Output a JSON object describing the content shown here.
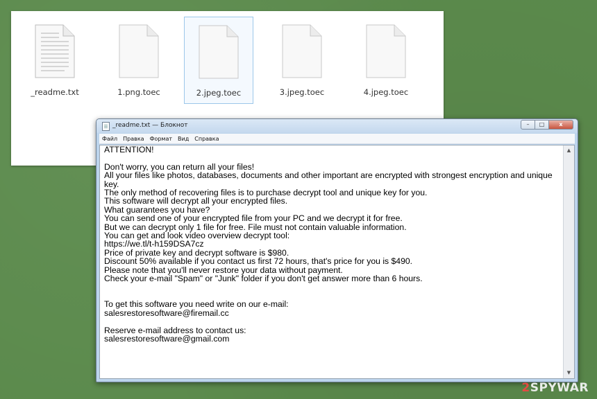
{
  "files": [
    {
      "name": "_readme.txt",
      "selected": false
    },
    {
      "name": "1.png.toec",
      "selected": false
    },
    {
      "name": "2.jpeg.toec",
      "selected": true
    },
    {
      "name": "3.jpeg.toec",
      "selected": false
    },
    {
      "name": "4.jpeg.toec",
      "selected": false
    }
  ],
  "notepad": {
    "title": "_readme.txt — Блокнот",
    "menu": [
      "Файл",
      "Правка",
      "Формат",
      "Вид",
      "Справка"
    ],
    "buttons": {
      "minimize": "–",
      "maximize": "□",
      "close": "x"
    },
    "scroll_up": "▲",
    "scroll_down": "▼",
    "content": "ATTENTION!\n\nDon't worry, you can return all your files!\nAll your files like photos, databases, documents and other important are encrypted with strongest encryption and unique key.\nThe only method of recovering files is to purchase decrypt tool and unique key for you.\nThis software will decrypt all your encrypted files.\nWhat guarantees you have?\nYou can send one of your encrypted file from your PC and we decrypt it for free.\nBut we can decrypt only 1 file for free. File must not contain valuable information.\nYou can get and look video overview decrypt tool:\nhttps://we.tl/t-h159DSA7cz\nPrice of private key and decrypt software is $980.\nDiscount 50% available if you contact us first 72 hours, that's price for you is $490.\nPlease note that you'll never restore your data without payment.\nCheck your e-mail \"Spam\" or \"Junk\" folder if you don't get answer more than 6 hours.\n\n\nTo get this software you need write on our e-mail:\nsalesrestoresoftware@firemail.cc\n\nReserve e-mail address to contact us:\nsalesrestoresoftware@gmail.com"
  },
  "watermark": {
    "prefix": "2",
    "rest": "SPYWAR"
  },
  "colors": {
    "desktop": "#5b8a4c",
    "selection": "#9cc7ea",
    "close_button": "#c8553f",
    "watermark_accent": "#e34b43"
  }
}
